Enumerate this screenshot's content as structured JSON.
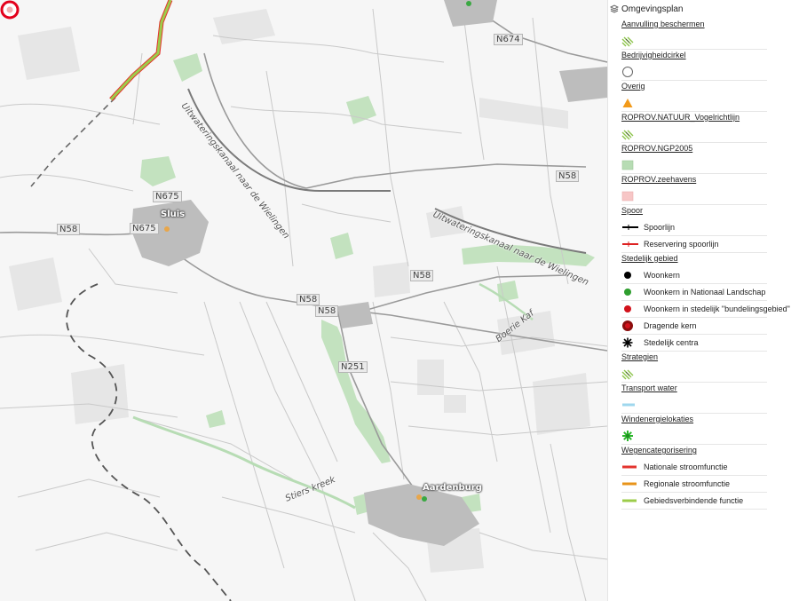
{
  "map": {
    "road_labels": [
      {
        "id": "n674",
        "text": "N674"
      },
      {
        "id": "n675-a",
        "text": "N675"
      },
      {
        "id": "n675-b",
        "text": "N675"
      },
      {
        "id": "n58-a",
        "text": "N58"
      },
      {
        "id": "n58-b",
        "text": "N58"
      },
      {
        "id": "n58-c",
        "text": "N58"
      },
      {
        "id": "n58-d",
        "text": "N58"
      },
      {
        "id": "n58-e",
        "text": "N58"
      },
      {
        "id": "n251",
        "text": "N251"
      }
    ],
    "places": [
      {
        "id": "sluis",
        "text": "Sluis"
      },
      {
        "id": "aardenburg",
        "text": "Aardenburg"
      }
    ],
    "water_labels": [
      {
        "id": "kanaal-1",
        "text": "Uitwateringskanaal naar de Wielingen"
      },
      {
        "id": "kanaal-2",
        "text": "Uitwateringskanaal naar de Wielingen"
      },
      {
        "id": "boerekreek",
        "text": "Boerie Kaf"
      },
      {
        "id": "stierskreek",
        "text": "Stiers kreek"
      }
    ],
    "marker_icon": "location-marker-icon"
  },
  "legend": {
    "title": "Omgevingsplan",
    "groups": [
      {
        "header": "Aanvulling beschermen",
        "items": [
          {
            "symbol": "hatch",
            "label": ""
          }
        ]
      },
      {
        "header": "Bedrijvigheidcirkel",
        "items": [
          {
            "symbol": "circle-outline",
            "label": ""
          }
        ]
      },
      {
        "header": "Overig",
        "items": [
          {
            "symbol": "triangle-orange",
            "label": ""
          }
        ]
      },
      {
        "header": "ROPROV.NATUUR_Vogelrichtlijn",
        "items": [
          {
            "symbol": "hatch",
            "label": ""
          }
        ]
      },
      {
        "header": "ROPROV.NGP2005",
        "items": [
          {
            "symbol": "fill-green",
            "label": ""
          }
        ]
      },
      {
        "header": "ROPROV.zeehavens",
        "items": [
          {
            "symbol": "fill-pink",
            "label": ""
          }
        ]
      },
      {
        "header": "Spoor",
        "items": [
          {
            "symbol": "rail-black",
            "label": "Spoorlijn"
          },
          {
            "symbol": "rail-red",
            "label": "Reservering spoorlijn"
          }
        ]
      },
      {
        "header": "Stedelijk gebied",
        "items": [
          {
            "symbol": "dot-black",
            "label": "Woonkern"
          },
          {
            "symbol": "dot-green",
            "label": "Woonkern in Nationaal Landschap"
          },
          {
            "symbol": "dot-red",
            "label": "Woonkern in stedelijk \"bundelingsgebied\""
          },
          {
            "symbol": "dot-darkred",
            "label": "Dragende kern"
          },
          {
            "symbol": "asterisk-black",
            "label": "Stedelijk centra"
          }
        ]
      },
      {
        "header": "Strategien",
        "items": [
          {
            "symbol": "hatch",
            "label": ""
          }
        ]
      },
      {
        "header": "Transport water",
        "items": [
          {
            "symbol": "line-lightblue",
            "label": ""
          }
        ]
      },
      {
        "header": "Windenergielokaties",
        "items": [
          {
            "symbol": "asterisk-green",
            "label": ""
          }
        ]
      },
      {
        "header": "Wegencategorisering",
        "items": [
          {
            "symbol": "line-red",
            "label": "Nationale stroomfunctie"
          },
          {
            "symbol": "line-orange",
            "label": "Regionale stroomfunctie"
          },
          {
            "symbol": "line-yellowgreen",
            "label": "Gebiedsverbindende functie"
          }
        ]
      }
    ]
  },
  "colors": {
    "green_area": "#b7dcb4",
    "marker_red": "#e3001b",
    "national": "#e3342f",
    "regional": "#e8941a",
    "area_connecting": "#9ccc4a",
    "water": "#9fd7ee"
  }
}
